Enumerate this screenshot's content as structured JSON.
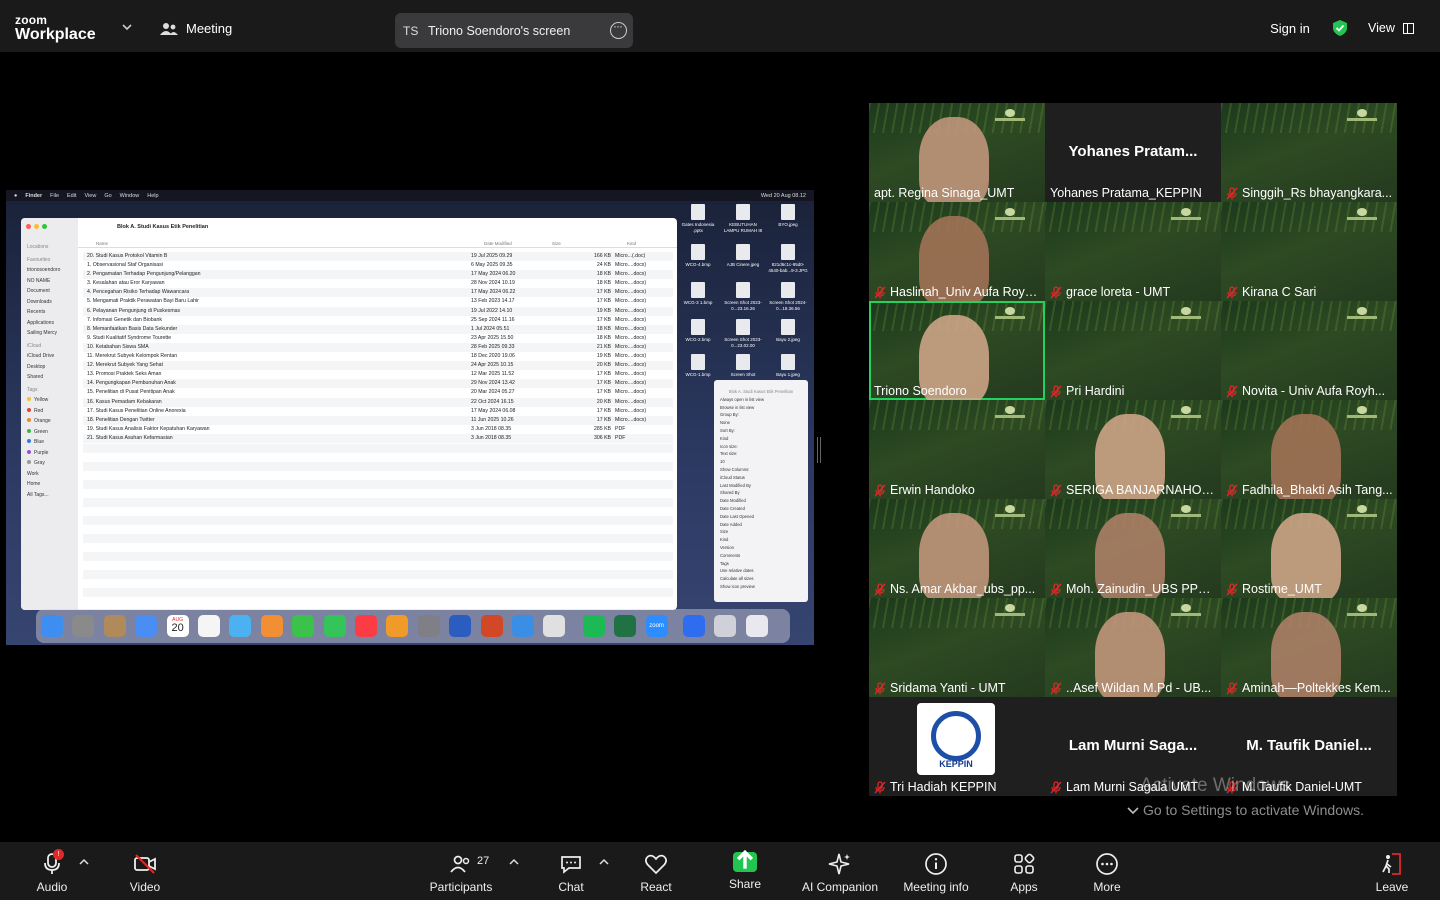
{
  "app": {
    "brand_line1": "zoom",
    "brand_line2": "Workplace",
    "meeting_label": "Meeting"
  },
  "share_pill": {
    "initials": "TS",
    "name": "Triono Soendoro's screen"
  },
  "header_right": {
    "signin": "Sign in",
    "view": "View"
  },
  "colors": {
    "topbar": "#1a1a1a",
    "active_speaker": "#23d160",
    "muted": "#e02828",
    "share_green": "#23c552"
  },
  "shared_screen": {
    "menubar": [
      "Finder",
      "File",
      "Edit",
      "View",
      "Go",
      "Window",
      "Help"
    ],
    "clock": "Wed 20 Aug 08.12",
    "finder_title": "Blok A. Studi Kasus Etik Penelitian",
    "sidebar": [
      "Locations",
      "Favourites",
      "trionosoendoro",
      "NO NAME",
      "Document",
      "Downloads",
      "Recents",
      "Applications",
      "Sailing Mercy",
      "iCloud",
      "iCloud Drive",
      "Desktop",
      "Shared",
      "Tags",
      "Yellow",
      "Red",
      "Orange",
      "Green",
      "Blue",
      "Purple",
      "Gray",
      "Work",
      "Home",
      "All Tags..."
    ],
    "columns": {
      "name": "Name",
      "date": "Date Modified",
      "size": "Size",
      "kind": "Kind"
    },
    "files": [
      {
        "n": "20. Studi Kasus Protokol Vitamin B",
        "d": "19 Jul 2025 09.29",
        "s": "166 KB",
        "k": "Micro...(.doc)"
      },
      {
        "n": "1. Observasional Staf Organisasi",
        "d": "6 May 2025 09.35",
        "s": "24 KB",
        "k": "Micro....docx)"
      },
      {
        "n": "2. Pengamatan Terhadap Pengunjung/Pelanggan",
        "d": "17 May 2024 06.20",
        "s": "18 KB",
        "k": "Micro....docx)"
      },
      {
        "n": "3. Kesalahan atau Eror Karyawan",
        "d": "28 Nov 2024 10.19",
        "s": "18 KB",
        "k": "Micro....docx)"
      },
      {
        "n": "4. Pencegahan Risiko Terhadap Wawancara",
        "d": "17 May 2024 06.22",
        "s": "17 KB",
        "k": "Micro....docx)"
      },
      {
        "n": "5. Mengamati Praktik Perawatan Bayi Baru Lahir",
        "d": "13 Feb 2023 14.17",
        "s": "17 KB",
        "k": "Micro....docx)"
      },
      {
        "n": "6. Pelayanan Pengunjung di Puskesmas",
        "d": "19 Jul 2022 14.10",
        "s": "19 KB",
        "k": "Micro....docx)"
      },
      {
        "n": "7. Infomasi Genetik dan Biobank",
        "d": "25 Sep 2024 11.16",
        "s": "17 KB",
        "k": "Micro....docx)"
      },
      {
        "n": "8. Memanfaatkan Basis Data Sekunder",
        "d": "1 Jul 2024 05.51",
        "s": "18 KB",
        "k": "Micro....docx)"
      },
      {
        "n": "9. Studi Kualitatif Syndrome Tourette",
        "d": "23 Apr 2025 15.50",
        "s": "18 KB",
        "k": "Micro....docx)"
      },
      {
        "n": "10. Ketabahan Siswa SMA",
        "d": "28 Feb 2025 09.33",
        "s": "21 KB",
        "k": "Micro....docx)"
      },
      {
        "n": "11. Merekrut Subyek Kelompok Rentan",
        "d": "18 Dec 2020 19.06",
        "s": "19 KB",
        "k": "Micro....docx)"
      },
      {
        "n": "12. Merekrut Subyek Yang Sehat",
        "d": "24 Apr 2025 10.15",
        "s": "20 KB",
        "k": "Micro....docx)"
      },
      {
        "n": "13. Promosi Praktek Seks Aman",
        "d": "12 Mar 2025 11.52",
        "s": "17 KB",
        "k": "Micro....docx)"
      },
      {
        "n": "14. Pengungkapan Pembunuhan Anak",
        "d": "29 Nov 2024 13.42",
        "s": "17 KB",
        "k": "Micro....docx)"
      },
      {
        "n": "15. Penelitian di Pusat Penitipan Anak",
        "d": "20 Mar 2024 05.27",
        "s": "17 KB",
        "k": "Micro....docx)"
      },
      {
        "n": "16. Kasus Pemadam Kebakaran",
        "d": "22 Oct 2024 16.15",
        "s": "20 KB",
        "k": "Micro....docx)"
      },
      {
        "n": "17. Studi Kasus Penelitian Online Anorexia",
        "d": "17 May 2024 06.08",
        "s": "17 KB",
        "k": "Micro....docx)"
      },
      {
        "n": "18. Penelitian Dengan Twitter",
        "d": "11 Jun 2025 10.26",
        "s": "17 KB",
        "k": "Micro....docx)"
      },
      {
        "n": "19. Studi Kasus Analisis Faktor Kepatuhan Karyawan",
        "d": "3 Jun 2018 08.35",
        "s": "285 KB",
        "k": "PDF"
      },
      {
        "n": "21. Studi Kasus Asuhan Kefarmasian",
        "d": "3 Jun 2018 08.35",
        "s": "306 KB",
        "k": "PDF"
      }
    ],
    "desktop_icons": [
      "Gates Indonesia .pptx",
      "KEBUTUHAN LAMPU RUMAH I8",
      "BYO.jpeg",
      "WCG-4.bmp",
      "AJB Cinere.jpeg",
      "821d6c1c-95d0-4540-bab...9-3.JPG",
      "WCG-3 1.bmp",
      "Screen Shot 2023-0...23.16.26",
      "Screen Shot 2024-0...18.36.56",
      "WCG-2.bmp",
      "Screen Shot 2023-0...23.02.00",
      "Bayu 2.jpeg",
      "WCG-1.bmp",
      "Screen Shot",
      "Bayu 1.jpeg"
    ],
    "inspector": [
      "Blok A. Studi Kasus Etik Penelitian",
      "Always open in list view",
      "Browse in list view",
      "Group By:",
      "None",
      "Sort By:",
      "Kind",
      "Icon size:",
      "Text size:",
      "10",
      "Show Columns:",
      "iCloud Status",
      "Last Modified By",
      "Shared By",
      "Date Modified",
      "Date Created",
      "Date Last Opened",
      "Date Added",
      "Size",
      "Kind",
      "Version",
      "Comments",
      "Tags",
      "Use relative dates",
      "Calculate all sizes",
      "Show icon preview"
    ],
    "dock_date": {
      "month": "AUG",
      "day": "20"
    },
    "dock_zoom": "zoom"
  },
  "participants": [
    {
      "name": "apt. Regina Sinaga_UMT",
      "muted": false,
      "video": true
    },
    {
      "name": "Yohanes Pratama_KEPPIN",
      "big": "Yohanes  Pratam...",
      "muted": false,
      "video": false
    },
    {
      "name": "Singgih_Rs bhayangkara...",
      "muted": true,
      "video": false
    },
    {
      "name": "Haslinah_Univ Aufa Royh...",
      "muted": true,
      "video": true
    },
    {
      "name": "grace loreta - UMT",
      "muted": true,
      "video": false
    },
    {
      "name": "Kirana C Sari",
      "muted": true,
      "video": false
    },
    {
      "name": "Triono Soendoro",
      "muted": false,
      "video": true,
      "active": true
    },
    {
      "name": "Pri Hardini",
      "muted": true,
      "video": false
    },
    {
      "name": "Novita - Univ Aufa Royh...",
      "muted": true,
      "video": false
    },
    {
      "name": "Erwin Handoko",
      "muted": true,
      "video": false
    },
    {
      "name": "SERIGA BANJARNAHOR,...",
      "muted": true,
      "video": true
    },
    {
      "name": "Fadhila_Bhakti Asih Tang...",
      "muted": true,
      "video": true
    },
    {
      "name": "Ns. Amar Akbar_ubs_pp...",
      "muted": true,
      "video": true
    },
    {
      "name": "Moh. Zainudin_UBS PPNI...",
      "muted": true,
      "video": true
    },
    {
      "name": "Rostime_UMT",
      "muted": true,
      "video": true
    },
    {
      "name": "Sridama Yanti - UMT",
      "muted": true,
      "video": false
    },
    {
      "name": "..Asef Wildan M.Pd - UB...",
      "muted": true,
      "video": true
    },
    {
      "name": "Aminah—Poltekkes Kem...",
      "muted": true,
      "video": true
    },
    {
      "name": "Tri Hadiah KEPPIN",
      "muted": true,
      "video": false,
      "logo": "KEPPIN"
    },
    {
      "name": "Lam Murni Sagala UMT",
      "big": "Lam  Murni  Saga...",
      "muted": true,
      "video": false
    },
    {
      "name": "M. Taufik Daniel-UMT",
      "big": "M.  Taufik  Daniel...",
      "muted": true,
      "video": false
    }
  ],
  "watermark": {
    "line1": "Activate Windows",
    "line2": "Go to Settings to activate Windows."
  },
  "toolbar": {
    "audio": "Audio",
    "video": "Video",
    "participants": "Participants",
    "participants_count": "27",
    "chat": "Chat",
    "react": "React",
    "share": "Share",
    "ai": "AI Companion",
    "info": "Meeting info",
    "apps": "Apps",
    "more": "More",
    "leave": "Leave"
  }
}
